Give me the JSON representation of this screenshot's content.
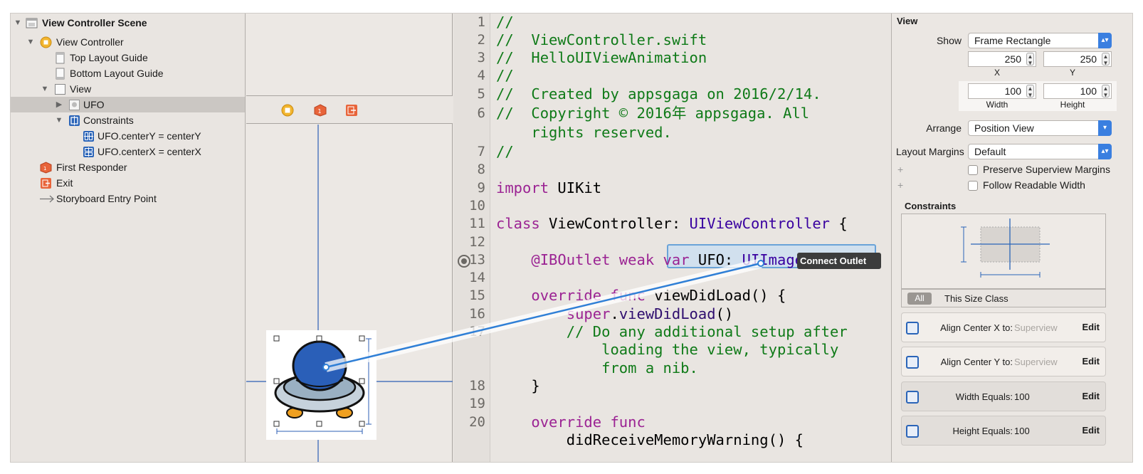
{
  "outline": {
    "items": [
      {
        "label": "View Controller Scene",
        "icon": "scene-icon"
      },
      {
        "label": "View Controller",
        "icon": "view-controller-icon"
      },
      {
        "label": "Top Layout Guide",
        "icon": "layout-guide-icon"
      },
      {
        "label": "Bottom Layout Guide",
        "icon": "layout-guide-icon"
      },
      {
        "label": "View",
        "icon": "view-icon"
      },
      {
        "label": "UFO",
        "icon": "image-view-icon"
      },
      {
        "label": "Constraints",
        "icon": "constraints-icon"
      },
      {
        "label": "UFO.centerY = centerY",
        "icon": "constraint-icon"
      },
      {
        "label": "UFO.centerX = centerX",
        "icon": "constraint-icon"
      },
      {
        "label": "First Responder",
        "icon": "first-responder-icon"
      },
      {
        "label": "Exit",
        "icon": "exit-icon"
      },
      {
        "label": "Storyboard Entry Point",
        "icon": "arrow-right-icon"
      }
    ]
  },
  "code": {
    "lines": [
      {
        "n": "1",
        "t": "//"
      },
      {
        "n": "2",
        "t": "//  ViewController.swift"
      },
      {
        "n": "3",
        "t": "//  HelloUIViewAnimation"
      },
      {
        "n": "4",
        "t": "//"
      },
      {
        "n": "5",
        "t": "//  Created by appsgaga on 2016/2/14."
      },
      {
        "n": "6",
        "t": "//  Copyright © 2016年 appsgaga. All"
      },
      {
        "n": "",
        "t": "    rights reserved."
      },
      {
        "n": "7",
        "t": "//"
      },
      {
        "n": "8",
        "t": ""
      },
      {
        "n": "9",
        "t": "import UIKit"
      },
      {
        "n": "10",
        "t": ""
      },
      {
        "n": "11",
        "t": "class ViewController: UIViewController {"
      },
      {
        "n": "12",
        "t": ""
      },
      {
        "n": "13",
        "t": "    @IBOutlet weak var UFO: UIImageView!"
      },
      {
        "n": "14",
        "t": ""
      },
      {
        "n": "15",
        "t": "    override func viewDidLoad() {"
      },
      {
        "n": "16",
        "t": "        super.viewDidLoad()"
      },
      {
        "n": "17",
        "t": "        // Do any additional setup after"
      },
      {
        "n": "",
        "t": "            loading the view, typically"
      },
      {
        "n": "",
        "t": "            from a nib."
      },
      {
        "n": "18",
        "t": "    }"
      },
      {
        "n": "19",
        "t": ""
      },
      {
        "n": "20",
        "t": "    override func"
      },
      {
        "n": "",
        "t": "        didReceiveMemoryWarning() {"
      }
    ]
  },
  "tooltip": {
    "label": "Connect Outlet"
  },
  "inspector": {
    "section_view": "View",
    "show_label": "Show",
    "show_value": "Frame Rectangle",
    "x_value": "250",
    "y_value": "250",
    "x_label": "X",
    "y_label": "Y",
    "width_value": "100",
    "height_value": "100",
    "width_label": "Width",
    "height_label": "Height",
    "arrange_label": "Arrange",
    "arrange_value": "Position View",
    "margins_label": "Layout Margins",
    "margins_value": "Default",
    "preserve_label": "Preserve Superview Margins",
    "readable_label": "Follow Readable Width",
    "constraints_title": "Constraints",
    "all_label": "All",
    "size_class_label": "This Size Class",
    "constraints": [
      {
        "label": "Align Center X to:",
        "value": "Superview",
        "edit": "Edit",
        "icon": "align-center-x-icon"
      },
      {
        "label": "Align Center Y to:",
        "value": "Superview",
        "edit": "Edit",
        "icon": "align-center-y-icon"
      },
      {
        "label": "Width Equals:",
        "value": "100",
        "edit": "Edit",
        "icon": "width-constraint-icon"
      },
      {
        "label": "Height Equals:",
        "value": "100",
        "edit": "Edit",
        "icon": "height-constraint-icon"
      }
    ]
  },
  "colors": {
    "accent": "#3a7fe0",
    "comment": "#0f7a18",
    "keyword": "#9b2393",
    "type": "#3900a0",
    "connection_line": "#2f7fd6",
    "ufo_body": "#2a5fb8"
  }
}
